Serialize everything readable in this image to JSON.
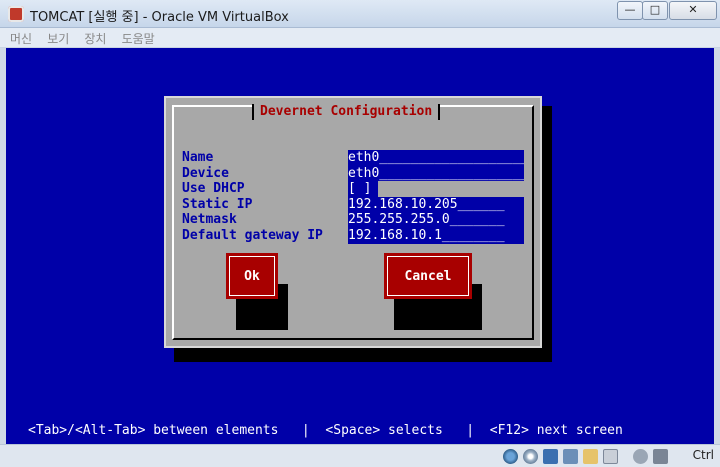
{
  "window": {
    "title": "TOMCAT [실행 중] - Oracle VM VirtualBox",
    "controls": {
      "minimize": "—",
      "maximize": "□",
      "close": "✕"
    }
  },
  "menubar": {
    "items": [
      "머신",
      "보기",
      "장치",
      "도움말"
    ]
  },
  "dialog": {
    "title": "Devernet Configuration",
    "labels": [
      "Name",
      "Device",
      "Use DHCP",
      "Static IP",
      "Netmask",
      "Default gateway IP"
    ],
    "fields": [
      "eth0____________________",
      "eth0____________________",
      "[ ]",
      "192.168.10.205______",
      "255.255.255.0_______",
      "192.168.10.1________"
    ],
    "ok_label": "Ok",
    "cancel_label": "Cancel"
  },
  "status_line": "<Tab>/<Alt-Tab> between elements   |  <Space> selects   |  <F12> next screen",
  "vbox_status": {
    "host_key": "Ctrl",
    "icons": [
      "hard-disk-icon",
      "optical-disk-icon",
      "network-icon",
      "usb-icon",
      "shared-folder-icon",
      "display-icon",
      "recording-icon",
      "mouse-integration-icon",
      "host-key-arrow-icon"
    ]
  },
  "colors": {
    "screen_bg": "#0000a8",
    "dialog_bg": "#a8a8a8",
    "title_red": "#a80000",
    "button_red": "#a80000"
  }
}
